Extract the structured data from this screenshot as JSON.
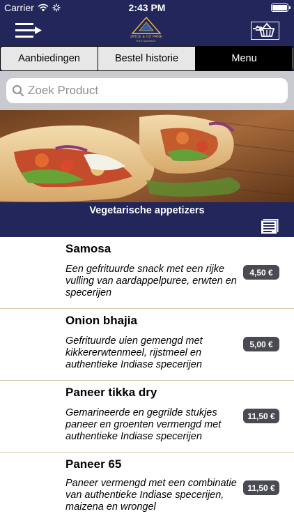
{
  "status_bar": {
    "carrier": "Carrier",
    "time": "2:43 PM",
    "icons": [
      "wifi-icon",
      "loading-icon",
      "battery-icon"
    ]
  },
  "nav_bar": {
    "logo_line1": "SPICE & CO PANE",
    "logo_line2": "RESTAURANT",
    "icons": [
      "menu-icon",
      "logo-icon",
      "shopping-basket-icon"
    ],
    "accent_color": "#22265a"
  },
  "tabs": [
    {
      "label": "Aanbiedingen",
      "selected": false
    },
    {
      "label": "Bestel historie",
      "selected": false
    },
    {
      "label": "Menu",
      "selected": true
    }
  ],
  "search": {
    "placeholder": "Zoek Product"
  },
  "category": {
    "title": "Vegetarische appetizers",
    "icon": "document-list-icon"
  },
  "items": [
    {
      "name": "Samosa",
      "description": "Een gefrituurde snack met een rijke vulling van aardappelpuree, erwten en specerijen",
      "price": "4,50 €"
    },
    {
      "name": "Onion bhajia",
      "description": "Gefrituurde uien gemengd met kikkererwtenmeel, rijstmeel en authentieke Indiase specerijen",
      "price": "5,00 €"
    },
    {
      "name": "Paneer tikka dry",
      "description": "Gemarineerde en gegrilde stukjes paneer en groenten vermengd met authentieke Indiase specerijen",
      "price": "11,50 €"
    },
    {
      "name": "Paneer 65",
      "description": "Paneer vermengd met een combinatie van authentieke Indiase specerijen, maizena en wrongel",
      "price": "11,50 €"
    }
  ]
}
